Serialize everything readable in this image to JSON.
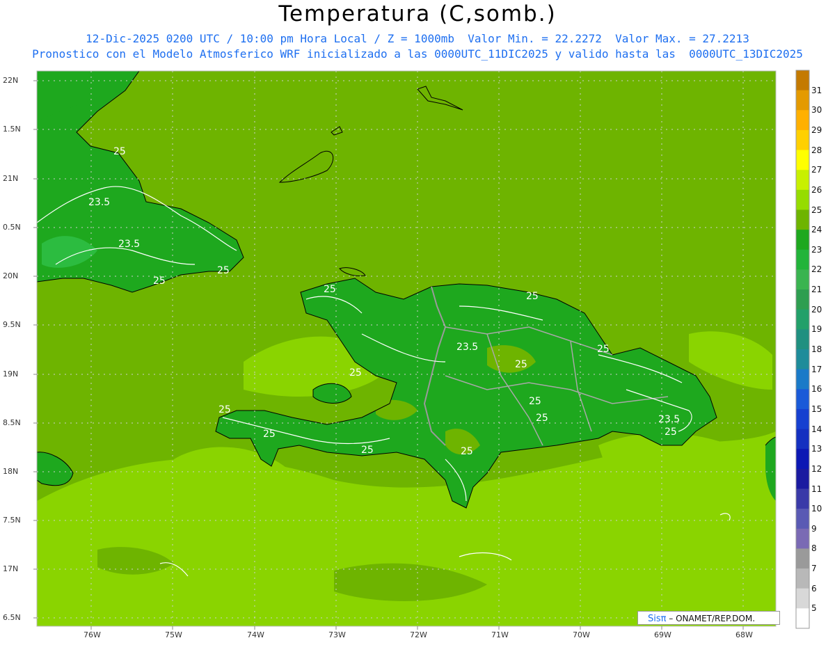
{
  "header": {
    "title": "Temperatura (C,somb.)",
    "line1": "12-Dic-2025 0200 UTC / 10:00 pm Hora Local / Z = 1000mb  Valor Min. = 22.2272  Valor Max. = 27.2213",
    "line2": "Pronostico con el Modelo Atmosferico WRF inicializado a las 0000UTC_11DIC2025 y valido hasta las  0000UTC_13DIC2025"
  },
  "axes": {
    "lat_labels": [
      "22N",
      "1.5N",
      "21N",
      "0.5N",
      "20N",
      "9.5N",
      "19N",
      "8.5N",
      "18N",
      "7.5N",
      "17N",
      "6.5N"
    ],
    "lon_labels": [
      "76W",
      "75W",
      "74W",
      "73W",
      "72W",
      "71W",
      "70W",
      "69W",
      "68W"
    ]
  },
  "contour_labels": [
    "25",
    "23.5",
    "23.5",
    "25",
    "25",
    "25",
    "25",
    "25",
    "23.5",
    "25",
    "25",
    "25",
    "25",
    "25",
    "25",
    "25",
    "23.5",
    "25",
    "25"
  ],
  "colorbar": {
    "labels": [
      "31",
      "30",
      "29",
      "28",
      "27",
      "26",
      "25",
      "24",
      "23",
      "22",
      "21",
      "20",
      "19",
      "18",
      "17",
      "16",
      "15",
      "14",
      "13",
      "12",
      "11",
      "10",
      "9",
      "8",
      "7",
      "6",
      "5"
    ],
    "colors": [
      "#c47a00",
      "#e49a00",
      "#ffb000",
      "#ffd000",
      "#ffff00",
      "#c8f000",
      "#96dc00",
      "#6eb400",
      "#1ea81e",
      "#22b43a",
      "#3ab450",
      "#2e9e50",
      "#22a06a",
      "#209080",
      "#1e8c9a",
      "#1a7ac8",
      "#1a5ad8",
      "#1640d0",
      "#1430c0",
      "#0c18b4",
      "#1a1aa0",
      "#3a3aa8",
      "#5a5ab4",
      "#7a6ab4",
      "#9a9a9a",
      "#b8b8b8",
      "#d8d8d8",
      "#ffffff"
    ]
  },
  "credit": {
    "logo": "Sisπ",
    "text": "– ONAMET/REP.DOM."
  }
}
